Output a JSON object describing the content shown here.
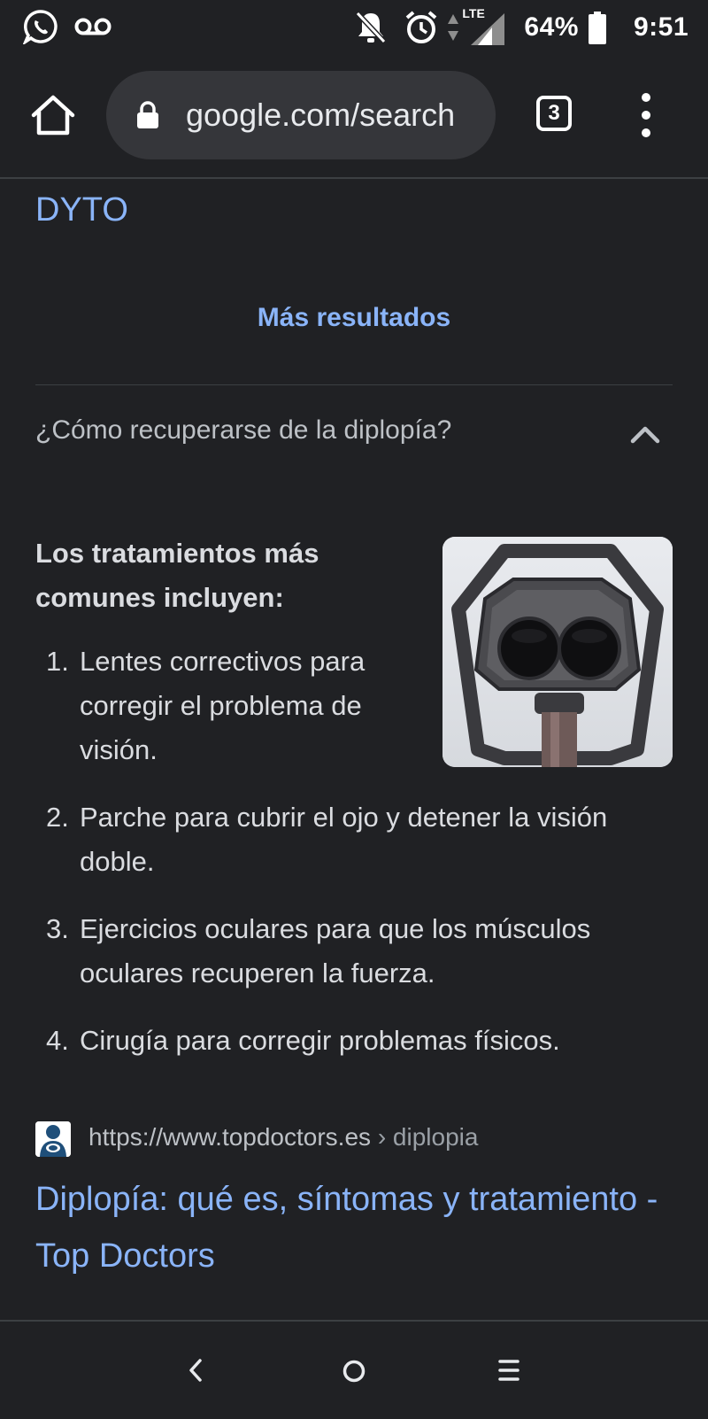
{
  "status_bar": {
    "battery": "64%",
    "time": "9:51",
    "network": "LTE",
    "icons": [
      "whatsapp-icon",
      "voicemail-icon",
      "notifications-off-icon",
      "alarm-icon",
      "data-arrows-icon",
      "signal-icon",
      "battery-icon"
    ]
  },
  "toolbar": {
    "url": "google.com/search",
    "tab_count": "3",
    "icons": [
      "home-icon",
      "lock-icon",
      "tabs-icon",
      "more-vert-icon"
    ]
  },
  "content": {
    "previous_result_link": "DYTO",
    "more_results": "Más resultados",
    "question": "¿Cómo recuperarse de la diplopía?",
    "answer_heading": "Los tratamientos más comunes incluyen:",
    "answer_items": [
      {
        "num": "1.",
        "text": "Lentes correctivos para corregir el problema de visión."
      },
      {
        "num": "2.",
        "text": "Parche para cubrir el ojo y detener la visión doble."
      },
      {
        "num": "3.",
        "text": "Ejercicios oculares para que los músculos oculares recuperen la fuerza."
      },
      {
        "num": "4.",
        "text": "Cirugía para corregir problemas físicos."
      }
    ],
    "source": {
      "url": "https://www.topdoctors.es",
      "path": " › diplopia"
    },
    "result_title": "Diplopía: qué es, síntomas y tratamiento - Top Doctors"
  },
  "colors": {
    "background": "#202124",
    "link": "#8ab4f8",
    "text": "#dadce0",
    "omnibox": "#35363a"
  }
}
